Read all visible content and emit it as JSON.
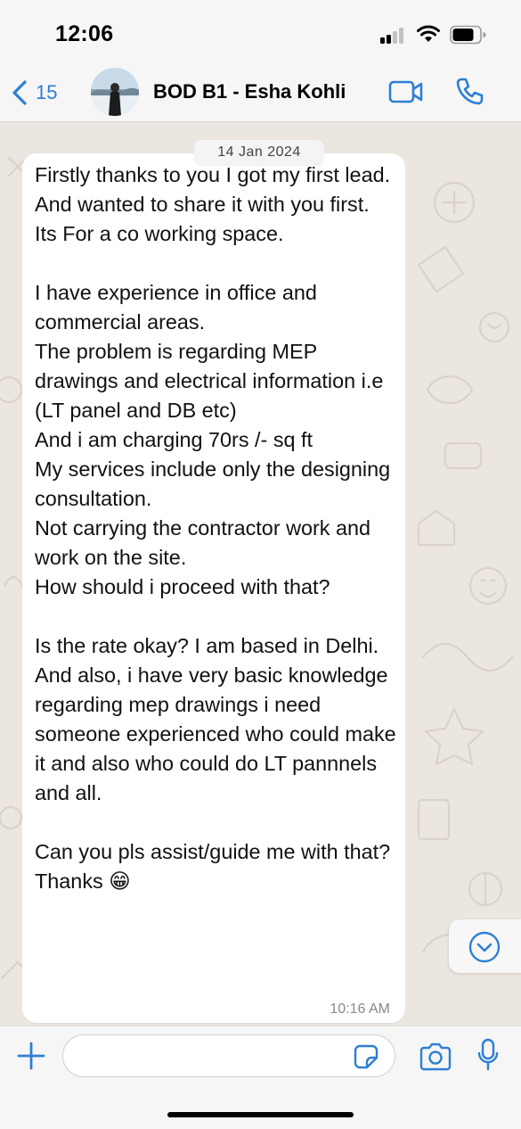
{
  "status_bar": {
    "time": "12:06"
  },
  "header": {
    "back_count": "15",
    "contact_name": "BOD B1 - Esha Kohli"
  },
  "chat": {
    "date_chip": "14 Jan 2024",
    "message": {
      "text": "Firstly thanks to you I got my first lead. And wanted to share it with you first.\nIts For a co working space.\n\nI have experience in office and commercial areas.\nThe problem is regarding MEP drawings and electrical information i.e (LT panel and DB etc)\nAnd i am charging 70rs /- sq ft\nMy services include only the designing consultation.\nNot carrying the contractor work and work on the site.\nHow should i proceed with that?\n\nIs the rate okay? I am based in Delhi.\nAnd also, i have very basic knowledge regarding mep drawings i need someone experienced who could make it and also who could do LT pannnels and all.\n\nCan you pls assist/guide me with that?\nThanks 😁",
      "time": "10:16 AM"
    }
  },
  "composer": {
    "input_value": ""
  },
  "colors": {
    "accent_blue": "#2d7fd3",
    "bubble_bg": "#ffffff",
    "wallpaper_bg": "#ebe6df",
    "bar_bg": "#f6f6f6"
  },
  "icons": {
    "back": "chevron-left-icon",
    "video": "video-camera-icon",
    "call": "phone-icon",
    "scroll": "chevron-down-circle-icon",
    "plus": "plus-icon",
    "sticker": "sticker-icon",
    "camera": "camera-icon",
    "mic": "microphone-icon"
  }
}
